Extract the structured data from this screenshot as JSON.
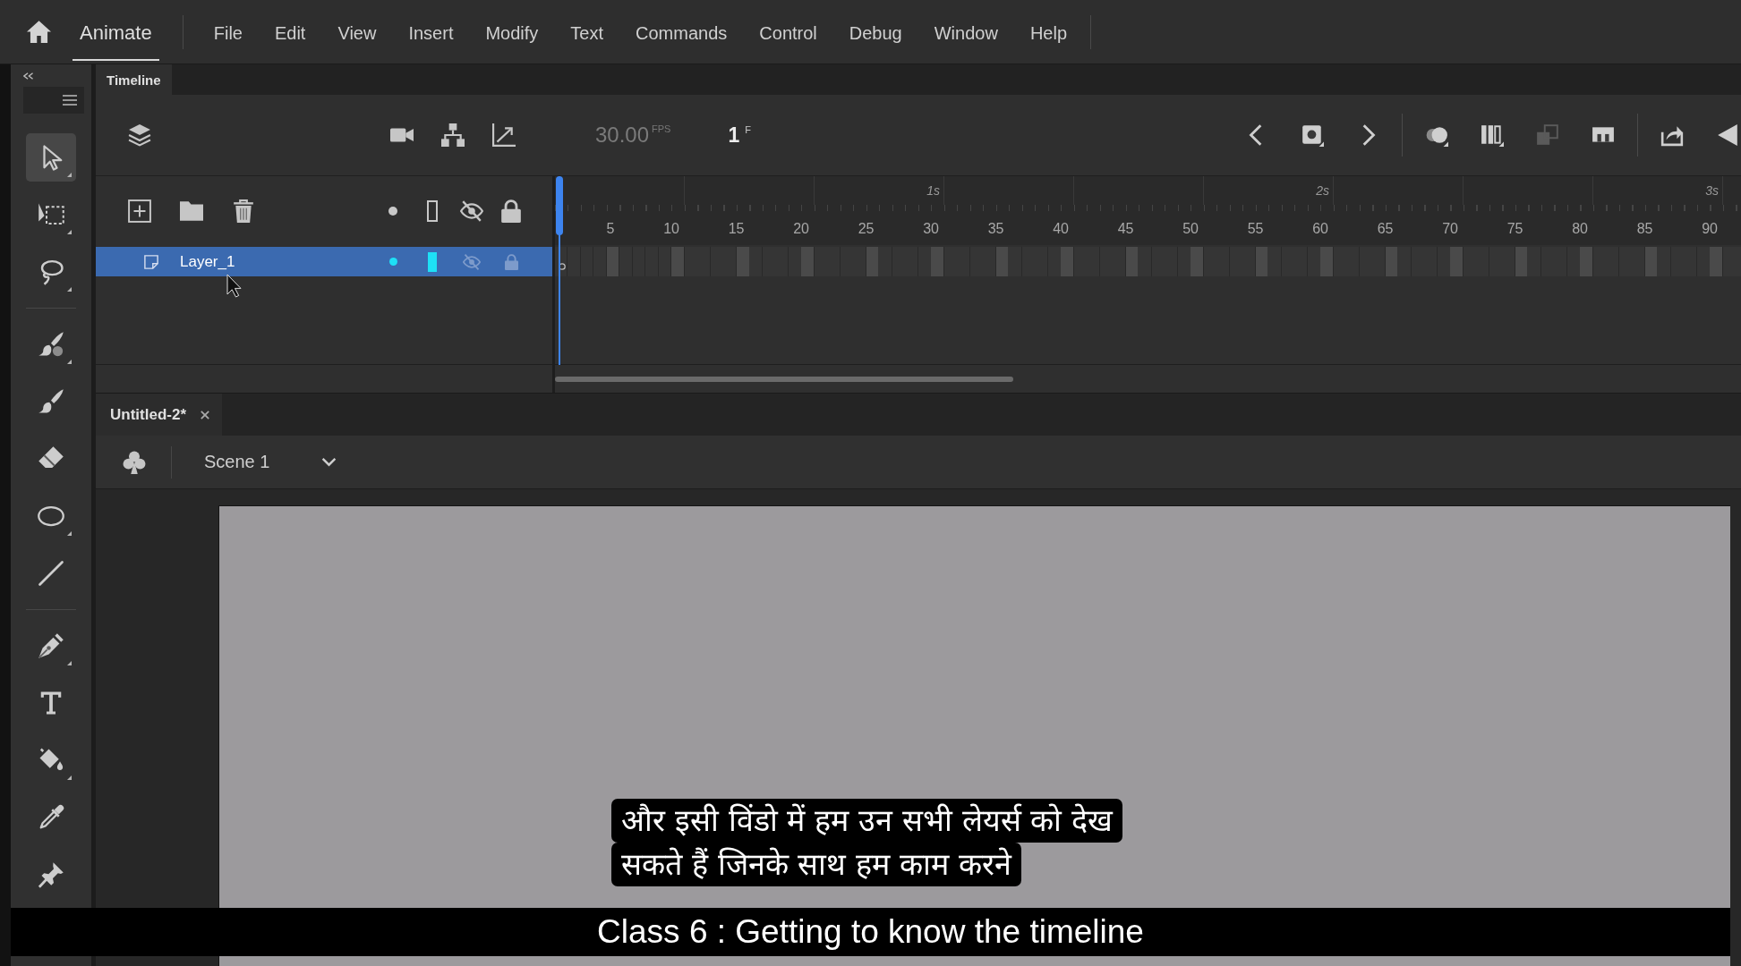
{
  "menu_bar": {
    "app_tab": {
      "label": "Animate",
      "selected": true
    },
    "items": [
      "File",
      "Edit",
      "View",
      "Insert",
      "Modify",
      "Text",
      "Commands",
      "Control",
      "Debug",
      "Window",
      "Help"
    ]
  },
  "tools_panel": {
    "groups": [
      {
        "tools": [
          {
            "kind": "selection",
            "selected": true,
            "flyout": true
          },
          {
            "kind": "free-transform",
            "selected": false,
            "flyout": true
          },
          {
            "kind": "lasso",
            "selected": false,
            "flyout": true
          }
        ]
      },
      {
        "tools": [
          {
            "kind": "paint-brush",
            "selected": false,
            "flyout": true
          },
          {
            "kind": "brush",
            "selected": false,
            "flyout": false
          },
          {
            "kind": "eraser",
            "selected": false,
            "flyout": false
          },
          {
            "kind": "oval",
            "selected": false,
            "flyout": true
          },
          {
            "kind": "line",
            "selected": false,
            "flyout": false
          }
        ]
      },
      {
        "tools": [
          {
            "kind": "pen",
            "selected": false,
            "flyout": true
          },
          {
            "kind": "text",
            "selected": false,
            "flyout": false
          },
          {
            "kind": "bucket",
            "selected": false,
            "flyout": true
          },
          {
            "kind": "eyedropper",
            "selected": false,
            "flyout": false
          },
          {
            "kind": "pin",
            "selected": false,
            "flyout": false
          }
        ]
      }
    ]
  },
  "timeline": {
    "tab": {
      "label": "Timeline",
      "selected": true
    },
    "fps": "30.00",
    "fps_unit": "FPS",
    "current_frame": "1",
    "frame_unit": "F",
    "frame_controls": [
      [
        {
          "kind": "prev",
          "disabled": false
        },
        {
          "kind": "keyframe",
          "disabled": false
        },
        {
          "kind": "next",
          "disabled": false
        }
      ],
      [
        {
          "kind": "onion",
          "disabled": false
        },
        {
          "kind": "multi-frame",
          "disabled": false
        },
        {
          "kind": "copy",
          "disabled": true
        },
        {
          "kind": "fit",
          "disabled": false
        }
      ],
      [
        {
          "kind": "export",
          "disabled": false
        },
        {
          "kind": "collapse",
          "disabled": false
        }
      ]
    ],
    "ruler": {
      "seconds": [
        "1s",
        "2s",
        "3s"
      ],
      "frames": [
        "5",
        "10",
        "15",
        "20",
        "25",
        "30",
        "35",
        "40",
        "45",
        "50",
        "55",
        "60",
        "65",
        "70",
        "75",
        "80",
        "85",
        "90"
      ]
    },
    "layers": [
      {
        "name": "Layer_1",
        "selected": true,
        "color": "#1ee0f6",
        "hidden": false,
        "locked": false
      }
    ]
  },
  "document": {
    "tab": {
      "label": "Untitled-2*",
      "selected": true
    },
    "scene": "Scene 1"
  },
  "subtitle_lines": [
    "और इसी विंडो में हम उन सभी लेयर्स को देख",
    "सकते हैं जिनके साथ हम काम करने"
  ],
  "caption": "Class 6 : Getting to know the timeline"
}
